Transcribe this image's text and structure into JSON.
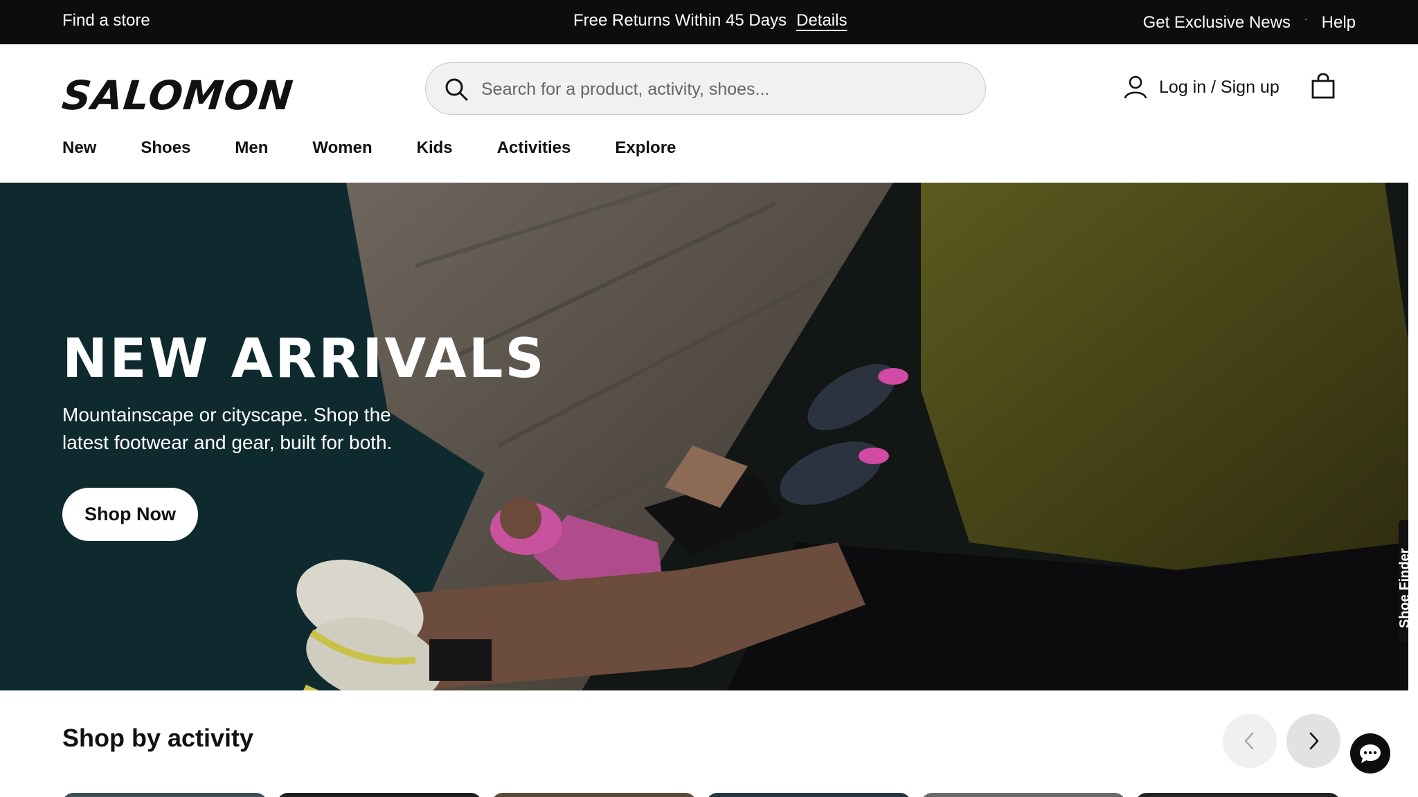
{
  "topbar": {
    "find_store": "Find a store",
    "promo": "Free Returns Within 45 Days",
    "promo_link": "Details",
    "news": "Get Exclusive News",
    "separator": "·",
    "help": "Help"
  },
  "header": {
    "logo": "SALOMON",
    "search_placeholder": "Search for a product, activity, shoes...",
    "account": "Log in / Sign up",
    "icons": [
      "search-icon",
      "user-icon",
      "shopping-bag-icon"
    ]
  },
  "nav": {
    "items": [
      {
        "label": "New"
      },
      {
        "label": "Shoes"
      },
      {
        "label": "Men"
      },
      {
        "label": "Women"
      },
      {
        "label": "Kids"
      },
      {
        "label": "Activities"
      },
      {
        "label": "Explore"
      }
    ]
  },
  "hero": {
    "title": "NEW ARRIVALS",
    "subtitle": "Mountainscape or cityscape. Shop the latest footwear and gear, built for both.",
    "cta": "Shop Now",
    "side_tab": "Shoe Finder"
  },
  "activity": {
    "title": "Shop by activity",
    "icons": [
      "chevron-left-icon",
      "chevron-right-icon",
      "chat-icon"
    ]
  },
  "colors": {
    "topbar_bg": "#0d0d0d",
    "hero_bg": "#0f2a2f",
    "shirt": "#4a4a18",
    "pink": "#c9529e"
  }
}
